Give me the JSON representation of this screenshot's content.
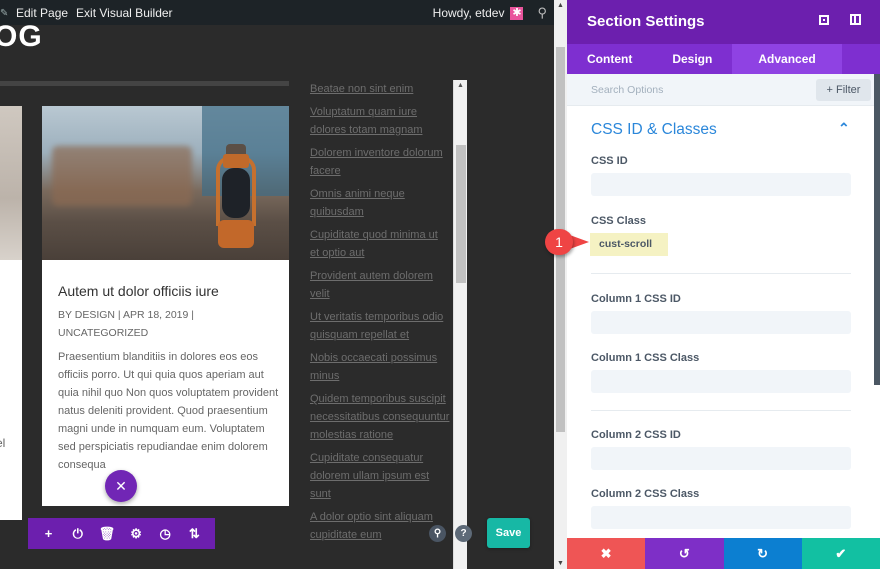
{
  "admin_bar": {
    "items": [
      "Edit Page",
      "Exit Visual Builder"
    ],
    "greeting": "Howdy, etdev",
    "avatar_glyph": "✱",
    "search_icon": "⚲"
  },
  "page": {
    "title_fragment": "OG",
    "left_card_fragment": "el"
  },
  "post_card": {
    "title": "Autem ut dolor officiis iure",
    "meta": "BY DESIGN | APR 18, 2019 | UNCATEGORIZED",
    "excerpt": "Praesentium blanditiis in dolores eos eos officiis porro. Ut qui quia quos aperiam aut quia nihil quo Non quos voluptatem provident natus deleniti provident. Quod praesentium magni unde in numquam eum. Voluptatem sed perspiciatis repudiandae enim dolorem consequa",
    "close_glyph": "✕"
  },
  "module_toolbar": {
    "icons": [
      {
        "name": "add-icon",
        "glyph": "+"
      },
      {
        "name": "power-icon",
        "glyph": "⏻"
      },
      {
        "name": "trash-icon",
        "glyph": "🗑"
      },
      {
        "name": "gear-icon",
        "glyph": "⚙"
      },
      {
        "name": "history-icon",
        "glyph": "◷"
      },
      {
        "name": "sort-icon",
        "glyph": "⇅"
      }
    ]
  },
  "sidebar_links": [
    "Beatae non sint enim",
    "Voluptatum quam iure dolores totam magnam",
    "Dolorem inventore dolorum facere",
    "Omnis animi neque quibusdam",
    "Cupiditate quod minima ut et optio aut",
    "Provident autem dolorem velit",
    "Ut veritatis temporibus odio quisquam repellat et",
    "Nobis occaecati possimus minus",
    "Quidem temporibus suscipit necessitatibus consequuntur molestias ratione",
    "Cupiditate consequatur dolorem ullam ipsum est sunt",
    "A dolor optio sint aliquam cupiditate eum"
  ],
  "floating": {
    "zoom_glyph": "⚲",
    "help_glyph": "?",
    "save_label": "Save"
  },
  "settings_panel": {
    "title": "Section Settings",
    "tabs": [
      {
        "label": "Content",
        "active": false
      },
      {
        "label": "Design",
        "active": false
      },
      {
        "label": "Advanced",
        "active": true
      }
    ],
    "search_placeholder": "Search Options",
    "filter_label": "+ Filter",
    "section_title": "CSS ID & Classes",
    "chevron": "⌃",
    "fields": [
      {
        "label": "CSS ID",
        "value": ""
      },
      {
        "label": "CSS Class",
        "value": "cust-scroll"
      },
      {
        "label": "Column 1 CSS ID",
        "value": ""
      },
      {
        "label": "Column 1 CSS Class",
        "value": ""
      },
      {
        "label": "Column 2 CSS ID",
        "value": ""
      },
      {
        "label": "Column 2 CSS Class",
        "value": ""
      }
    ],
    "footer": {
      "cancel_glyph": "✖",
      "undo_glyph": "↺",
      "redo_glyph": "↻",
      "save_glyph": "✔"
    }
  },
  "annotation": {
    "number": "1"
  },
  "colors": {
    "divi_purple": "#6c1fae",
    "tab_purple": "#7e2fd0",
    "active_tab": "#8f42e3",
    "section_blue": "#2b87da",
    "save_green": "#17b8a5",
    "cancel_red": "#ef5555",
    "redo_blue": "#0c7fd1"
  }
}
